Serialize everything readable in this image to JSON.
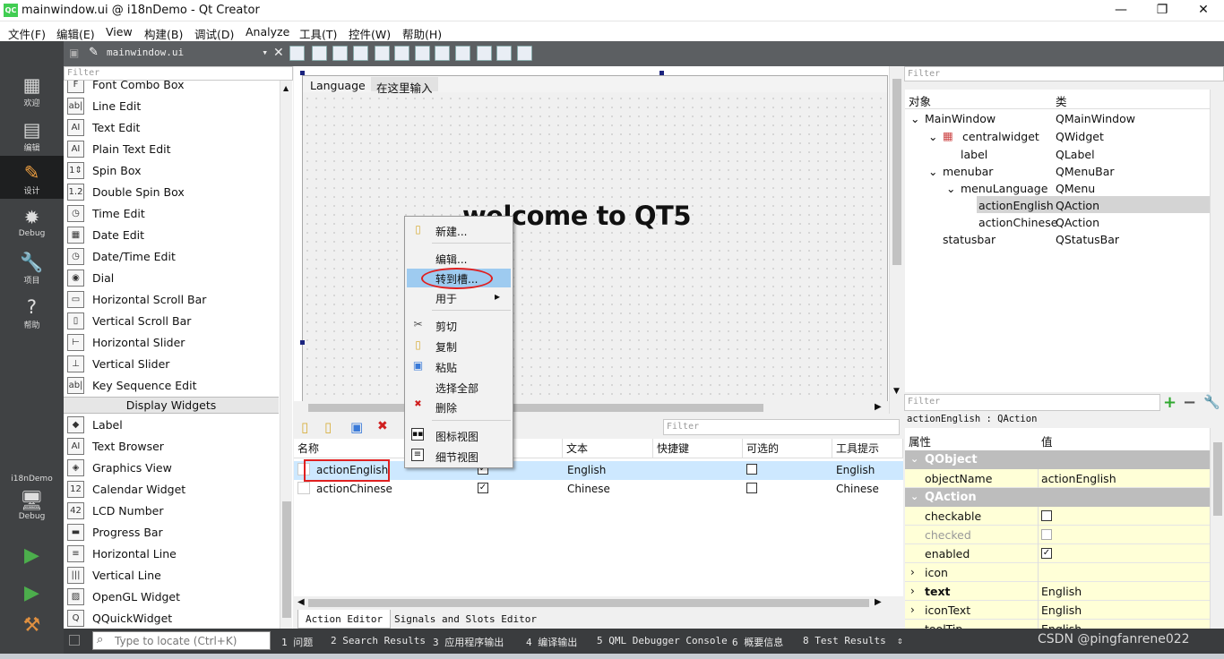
{
  "window": {
    "title": "mainwindow.ui @ i18nDemo - Qt Creator",
    "logo": "QC",
    "minimize": "—",
    "restore": "❐",
    "close": "✕"
  },
  "menu": [
    "文件(F)",
    "编辑(E)",
    "View",
    "构建(B)",
    "调试(D)",
    "Analyze",
    "工具(T)",
    "控件(W)",
    "帮助(H)"
  ],
  "modes": [
    {
      "label": "欢迎",
      "icon": "▦"
    },
    {
      "label": "编辑",
      "icon": "▤"
    },
    {
      "label": "设计",
      "icon": "✎"
    },
    {
      "label": "Debug",
      "icon": "✹"
    },
    {
      "label": "项目",
      "icon": "🔧"
    },
    {
      "label": "帮助",
      "icon": "?"
    }
  ],
  "kit": {
    "project": "i18nDemo",
    "label": "Debug",
    "icon": "🖥"
  },
  "editor": {
    "document": "mainwindow.ui",
    "filter_placeholder": "Filter"
  },
  "widgetbox": {
    "filter": "Filter",
    "items_top": [
      {
        "label": "Font Combo Box",
        "icon": "F"
      },
      {
        "label": "Line Edit",
        "icon": "ab|"
      },
      {
        "label": "Text Edit",
        "icon": "AI"
      },
      {
        "label": "Plain Text Edit",
        "icon": "AI"
      },
      {
        "label": "Spin Box",
        "icon": "1⇕"
      },
      {
        "label": "Double Spin Box",
        "icon": "1.2"
      },
      {
        "label": "Time Edit",
        "icon": "◷"
      },
      {
        "label": "Date Edit",
        "icon": "▦"
      },
      {
        "label": "Date/Time Edit",
        "icon": "◷"
      },
      {
        "label": "Dial",
        "icon": "◉"
      },
      {
        "label": "Horizontal Scroll Bar",
        "icon": "▭"
      },
      {
        "label": "Vertical Scroll Bar",
        "icon": "▯"
      },
      {
        "label": "Horizontal Slider",
        "icon": "⊢"
      },
      {
        "label": "Vertical Slider",
        "icon": "⊥"
      },
      {
        "label": "Key Sequence Edit",
        "icon": "ab|"
      }
    ],
    "category": "Display Widgets",
    "items_display": [
      {
        "label": "Label",
        "icon": "◆"
      },
      {
        "label": "Text Browser",
        "icon": "AI"
      },
      {
        "label": "Graphics View",
        "icon": "◈"
      },
      {
        "label": "Calendar Widget",
        "icon": "12"
      },
      {
        "label": "LCD Number",
        "icon": "42"
      },
      {
        "label": "Progress Bar",
        "icon": "▬"
      },
      {
        "label": "Horizontal Line",
        "icon": "≡"
      },
      {
        "label": "Vertical Line",
        "icon": "|||"
      },
      {
        "label": "OpenGL Widget",
        "icon": "▨"
      },
      {
        "label": "QQuickWidget",
        "icon": "Q"
      }
    ]
  },
  "form": {
    "menu_language": "Language",
    "menu_placeholder": "在这里输入",
    "welcome": "welcome to QT5"
  },
  "context_menu": {
    "items": [
      "新建...",
      "编辑...",
      "转到槽...",
      "用于",
      "剪切",
      "复制",
      "粘贴",
      "选择全部",
      "删除",
      "图标视图",
      "细节视图"
    ],
    "submenu_arrow": "▸"
  },
  "action_editor": {
    "filter": "Filter",
    "headers": [
      "名称",
      "",
      "文本",
      "快捷键",
      "可选的",
      "工具提示"
    ],
    "rows": [
      {
        "name": "actionEnglish",
        "text": "English",
        "shortcut": "",
        "checkable": false,
        "tooltip": "English"
      },
      {
        "name": "actionChinese",
        "text": "Chinese",
        "shortcut": "",
        "checkable": false,
        "tooltip": "Chinese"
      }
    ],
    "tabs": [
      "Action Editor",
      "Signals and Slots Editor"
    ]
  },
  "object_inspector": {
    "filter": "Filter",
    "headers": [
      "对象",
      "类"
    ],
    "tree": [
      {
        "name": "MainWindow",
        "class": "QMainWindow"
      },
      {
        "name": "centralwidget",
        "class": "QWidget"
      },
      {
        "name": "label",
        "class": "QLabel"
      },
      {
        "name": "menubar",
        "class": "QMenuBar"
      },
      {
        "name": "menuLanguage",
        "class": "QMenu"
      },
      {
        "name": "actionEnglish",
        "class": "QAction"
      },
      {
        "name": "actionChinese",
        "class": "QAction"
      },
      {
        "name": "statusbar",
        "class": "QStatusBar"
      }
    ]
  },
  "property_editor": {
    "filter": "Filter",
    "caption": "actionEnglish : QAction",
    "headers": [
      "属性",
      "值"
    ],
    "group_object": "QObject",
    "object_name_label": "objectName",
    "object_name_value": "actionEnglish",
    "group_action": "QAction",
    "props": [
      {
        "name": "checkable",
        "value": ""
      },
      {
        "name": "checked",
        "value": ""
      },
      {
        "name": "enabled",
        "value": "✓"
      },
      {
        "name": "icon",
        "value": ""
      },
      {
        "name": "text",
        "value": "English"
      },
      {
        "name": "iconText",
        "value": "English"
      },
      {
        "name": "toolTip",
        "value": "English"
      }
    ]
  },
  "statusbar": {
    "locate_placeholder": "Type to locate (Ctrl+K)",
    "panes": [
      "1 问题",
      "2 Search Results",
      "3 应用程序输出",
      "4 编译输出",
      "5 QML Debugger Console",
      "6 概要信息",
      "8 Test Results"
    ],
    "arrows": "⇕"
  },
  "watermark": "CSDN @pingfanrene022",
  "colors": {
    "accent": "#41cd52",
    "selection": "#cde8ff",
    "highlight_circle": "#e02020"
  }
}
